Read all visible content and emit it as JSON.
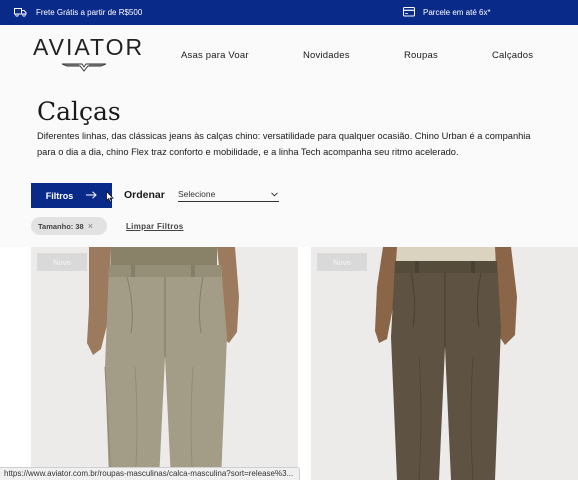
{
  "promo": {
    "shipping": "Frete Grátis a partir de R$500",
    "shipping_icon": "truck-icon",
    "installments": "Parcele em até 6x*",
    "installments_icon": "credit-card-icon",
    "background": "#0a2a8a"
  },
  "header": {
    "logo_text": "AVIATOR",
    "nav": [
      "Asas para Voar",
      "Novidades",
      "Roupas",
      "Calçados"
    ]
  },
  "category": {
    "title": "Calças",
    "description": "Diferentes linhas, das clássicas jeans às calças chino: versatilidade para qualquer ocasião. Chino Urban é a companhia para o dia a dia, chino Flex traz conforto e mobilidade, e a linha Tech acompanha seu ritmo acelerado."
  },
  "toolbar": {
    "filter_label": "Filtros",
    "filter_icon": "arrow-right-icon",
    "sort_label": "Ordenar",
    "sort_value": "Selecione",
    "sort_icon": "chevron-down-icon"
  },
  "active_filters": {
    "chip_label": "Tamanho: 38",
    "chip_close": "×",
    "clear_label": "Limpar Filtros"
  },
  "products": [
    {
      "badge": "Novo",
      "image": "khaki-chino-pants-photo",
      "color": "#a39c86"
    },
    {
      "badge": "Novo",
      "image": "brown-chino-pants-photo",
      "color": "#5e5342"
    }
  ],
  "status_bar": {
    "url": "https://www.aviator.com.br/roupas-masculinas/calca-masculina?sort=release%3..."
  },
  "colors": {
    "accent": "#0a2a8a",
    "chip_bg": "#e2e2e2",
    "page_bg": "#fafafa"
  }
}
